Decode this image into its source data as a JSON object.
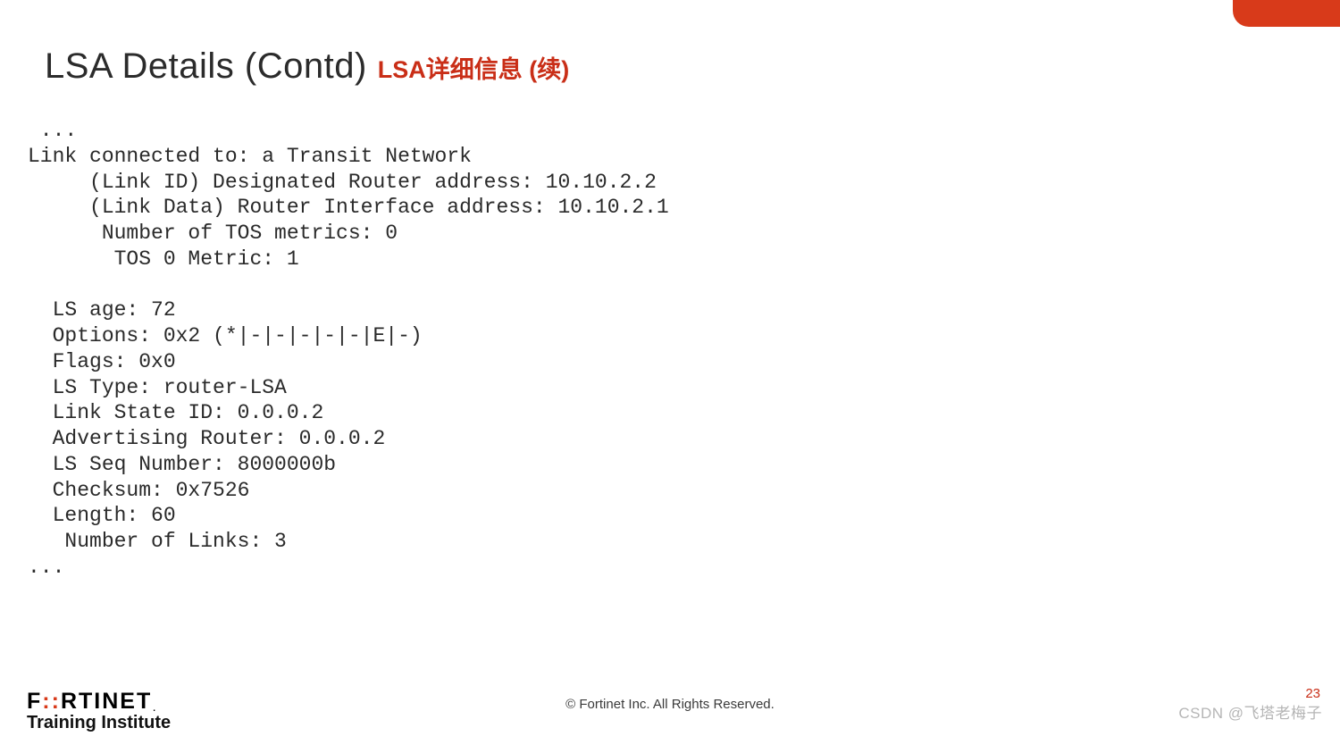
{
  "header": {
    "title_en": "LSA Details (Contd)",
    "title_zh": "LSA详细信息 (续)"
  },
  "code": " ...\nLink connected to: a Transit Network\n     (Link ID) Designated Router address: 10.10.2.2\n     (Link Data) Router Interface address: 10.10.2.1\n      Number of TOS metrics: 0\n       TOS 0 Metric: 1\n\n  LS age: 72\n  Options: 0x2 (*|-|-|-|-|-|E|-)\n  Flags: 0x0\n  LS Type: router-LSA\n  Link State ID: 0.0.0.2\n  Advertising Router: 0.0.0.2\n  LS Seq Number: 8000000b\n  Checksum: 0x7526\n  Length: 60\n   Number of Links: 3\n...",
  "footer": {
    "logo_sub": "Training Institute",
    "copyright": "© Fortinet Inc. All Rights Reserved.",
    "page_number": "23",
    "watermark": "CSDN @飞塔老梅子"
  }
}
